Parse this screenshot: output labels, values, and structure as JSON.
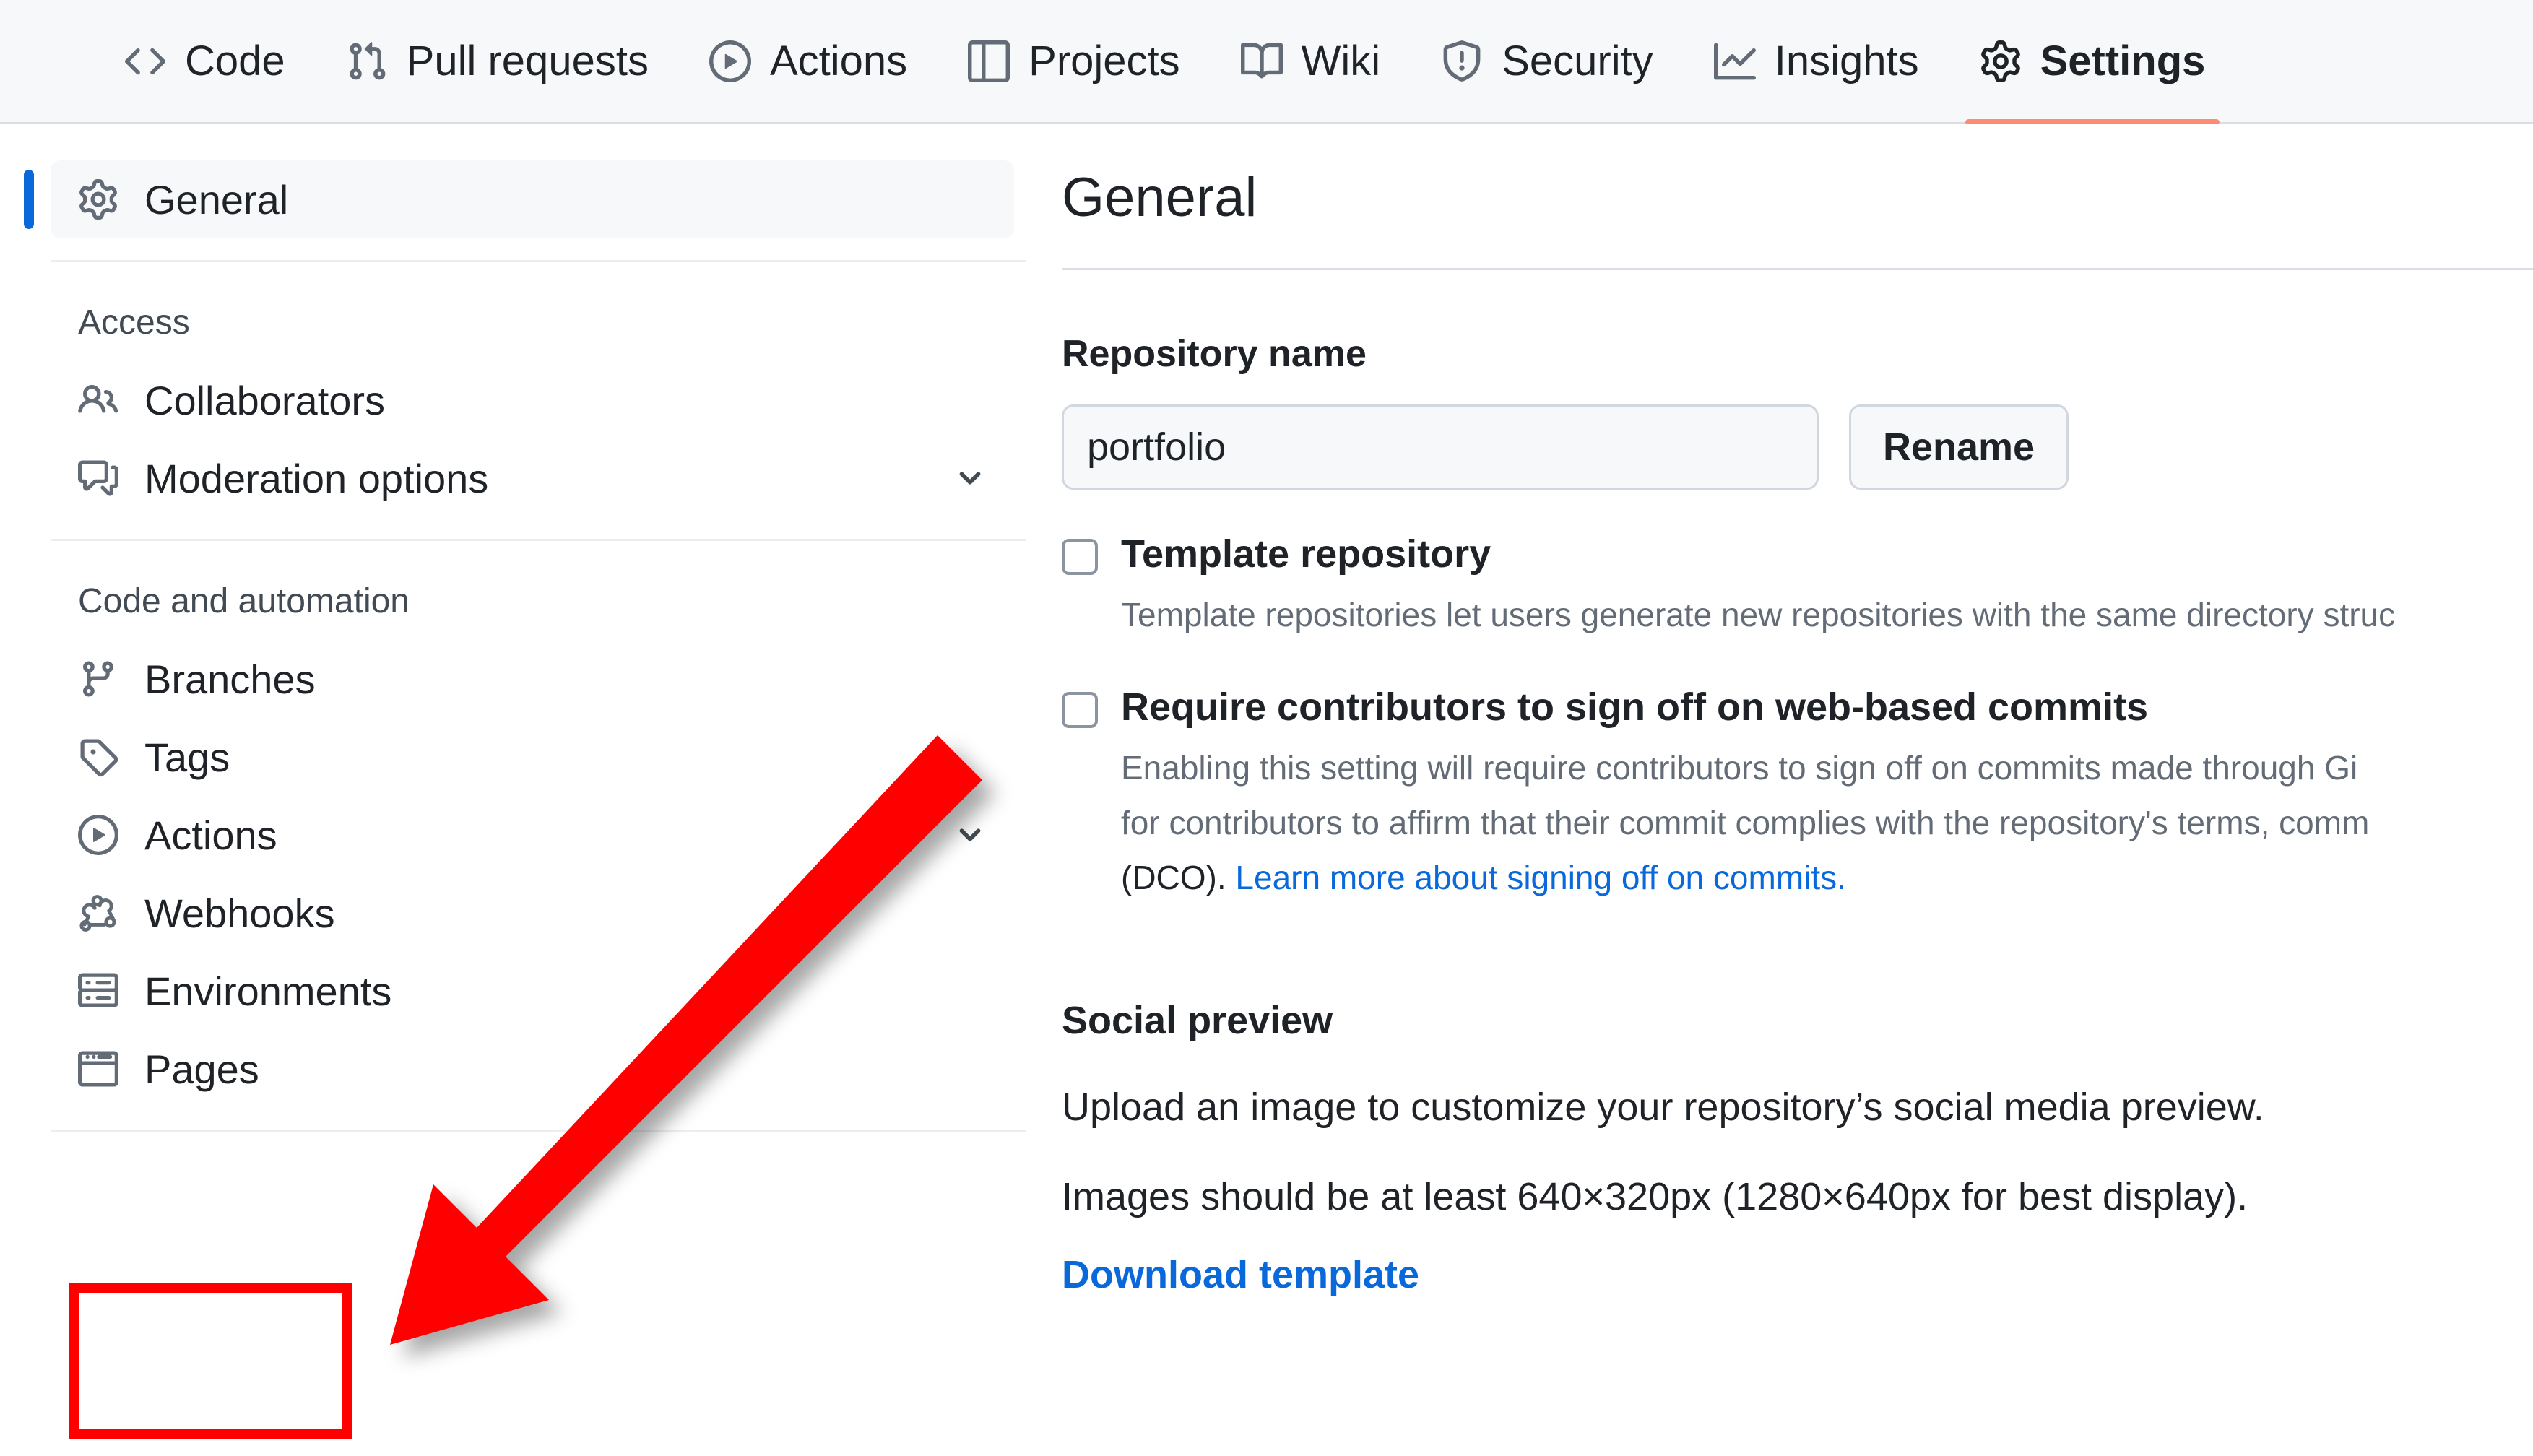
{
  "repo_nav": {
    "items": [
      {
        "label": "Code",
        "icon": "code-icon",
        "active": false
      },
      {
        "label": "Pull requests",
        "icon": "git-pull-request-icon",
        "active": false
      },
      {
        "label": "Actions",
        "icon": "play-circle-icon",
        "active": false
      },
      {
        "label": "Projects",
        "icon": "table-icon",
        "active": false
      },
      {
        "label": "Wiki",
        "icon": "book-icon",
        "active": false
      },
      {
        "label": "Security",
        "icon": "shield-alert-icon",
        "active": false
      },
      {
        "label": "Insights",
        "icon": "graph-icon",
        "active": false
      },
      {
        "label": "Settings",
        "icon": "gear-icon",
        "active": true
      }
    ],
    "active_underline_color": "#fd8c73"
  },
  "sidebar": {
    "selected_indicator_color": "#0969da",
    "general": {
      "label": "General",
      "icon": "gear-icon"
    },
    "groups": [
      {
        "heading": "Access",
        "items": [
          {
            "label": "Collaborators",
            "icon": "people-icon",
            "chevron": false
          },
          {
            "label": "Moderation options",
            "icon": "comment-discussion-icon",
            "chevron": true
          }
        ]
      },
      {
        "heading": "Code and automation",
        "items": [
          {
            "label": "Branches",
            "icon": "git-branch-icon",
            "chevron": false
          },
          {
            "label": "Tags",
            "icon": "tag-icon",
            "chevron": false
          },
          {
            "label": "Actions",
            "icon": "play-circle-icon",
            "chevron": true
          },
          {
            "label": "Webhooks",
            "icon": "webhook-icon",
            "chevron": false
          },
          {
            "label": "Environments",
            "icon": "server-icon",
            "chevron": false
          },
          {
            "label": "Pages",
            "icon": "browser-window-icon",
            "chevron": false
          }
        ]
      }
    ]
  },
  "main": {
    "title": "General",
    "repository_name": {
      "label": "Repository name",
      "value": "portfolio",
      "placeholder": "Repository name",
      "rename_button": "Rename"
    },
    "template_repository": {
      "title": "Template repository",
      "checked": false,
      "description": "Template repositories let users generate new repositories with the same directory struc"
    },
    "signoff": {
      "title": "Require contributors to sign off on web-based commits",
      "checked": false,
      "desc_line1": "Enabling this setting will require contributors to sign off on commits made through Gi",
      "desc_line2": "for contributors to affirm that their commit complies with the repository's terms, comm",
      "desc_line3_prefix": "(DCO). ",
      "desc_line3_link": "Learn more about signing off on commits."
    },
    "social_preview": {
      "title": "Social preview",
      "line1": "Upload an image to customize your repository’s social media preview.",
      "line2": "Images should be at least 640×320px (1280×640px for best display).",
      "download_link": "Download template"
    }
  },
  "annotations": {
    "highlight_color": "#ff0000",
    "arrow_color": "#ff0000",
    "highlight_target": "Pages",
    "arrow_target": "Pages"
  }
}
